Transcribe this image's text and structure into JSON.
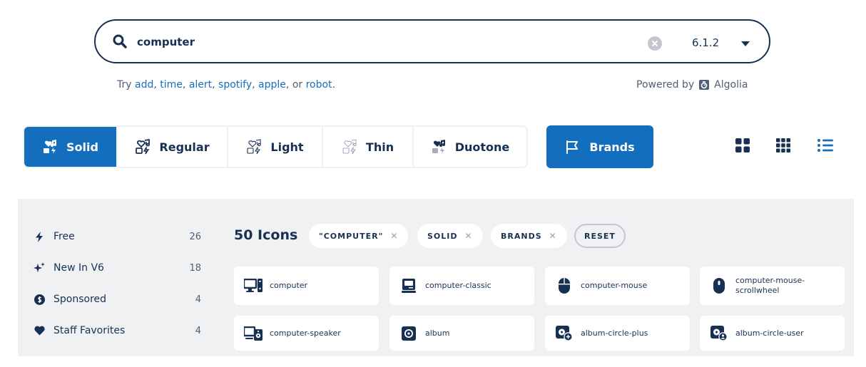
{
  "search": {
    "value": "computer",
    "version": "6.1.2"
  },
  "suggestions": {
    "prefix": "Try",
    "items": [
      "add",
      "time",
      "alert",
      "spotify",
      "apple",
      "robot"
    ],
    "connector": "or",
    "end": "."
  },
  "powered": {
    "label": "Powered by",
    "brand": "Algolia"
  },
  "styles": [
    {
      "label": "Solid",
      "active": true
    },
    {
      "label": "Regular",
      "active": false
    },
    {
      "label": "Light",
      "active": false
    },
    {
      "label": "Thin",
      "active": false
    },
    {
      "label": "Duotone",
      "active": false
    }
  ],
  "brands_label": "Brands",
  "view_modes": [
    "grid-large-icon",
    "grid-small-icon",
    "list-icon"
  ],
  "filters": [
    {
      "label": "Free",
      "count": "26",
      "icon": "bolt-icon"
    },
    {
      "label": "New In V6",
      "count": "18",
      "icon": "sparkles-icon"
    },
    {
      "label": "Sponsored",
      "count": "4",
      "icon": "dollar-circle-icon"
    },
    {
      "label": "Staff Favorites",
      "count": "4",
      "icon": "heart-icon"
    }
  ],
  "results": {
    "count_label": "50 Icons",
    "chips": [
      "\"COMPUTER\"",
      "SOLID",
      "BRANDS"
    ],
    "reset_label": "RESET",
    "icons": [
      [
        "computer"
      ],
      [
        "computer-classic"
      ],
      [
        "computer-mouse"
      ],
      [
        "computer-mouse-",
        "scrollwheel"
      ],
      [
        "computer-speaker"
      ],
      [
        "album"
      ],
      [
        "album-circle-plus"
      ],
      [
        "album-circle-user"
      ]
    ]
  },
  "colors": {
    "navy": "#183153",
    "primary_blue": "#146ebe",
    "panel_gray": "#f0f1f3",
    "link_blue": "#146ebe"
  }
}
